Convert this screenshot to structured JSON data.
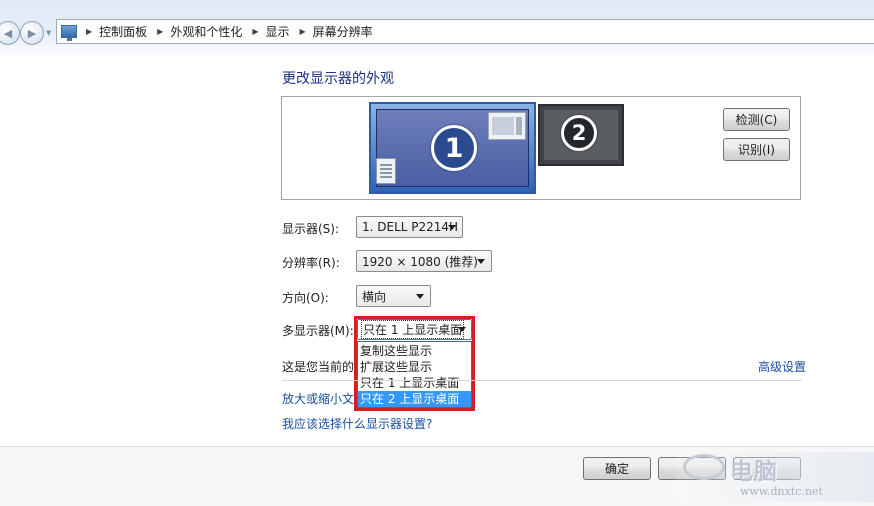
{
  "address_bar": {
    "breadcrumbs": [
      "控制面板",
      "外观和个性化",
      "显示",
      "屏幕分辨率"
    ],
    "icon": "control-panel-monitor-icon"
  },
  "page": {
    "heading": "更改显示器的外观"
  },
  "preview": {
    "monitors": [
      {
        "number": "1",
        "selected": true
      },
      {
        "number": "2",
        "selected": false
      }
    ],
    "detect_label": "检测(C)",
    "identify_label": "识别(I)"
  },
  "form": {
    "display_label": "显示器(S):",
    "display_value": "1. DELL P2214H",
    "resolution_label": "分辨率(R):",
    "resolution_value": "1920 × 1080 (推荐)",
    "orientation_label": "方向(O):",
    "orientation_value": "横向",
    "multi_label": "多显示器(M):",
    "multi_value": "只在 1 上显示桌面",
    "multi_options": [
      "复制这些显示",
      "扩展这些显示",
      "只在 1 上显示桌面",
      "只在 2 上显示桌面"
    ],
    "multi_highlighted_index": 3
  },
  "info": {
    "current_display_text": "这是您当前的主",
    "advanced_link": "高级设置",
    "text_size_link": "放大或缩小文本",
    "which_settings_link": "我应该选择什么显示器设置?"
  },
  "buttons": {
    "ok": "确定"
  },
  "colors": {
    "highlight": "#3399ff",
    "callout_border": "#d61d22",
    "link": "#1b4ea1",
    "heading": "#1e3287"
  },
  "watermark": {
    "brand": "电脑",
    "url": "www.dnxtc.net"
  }
}
